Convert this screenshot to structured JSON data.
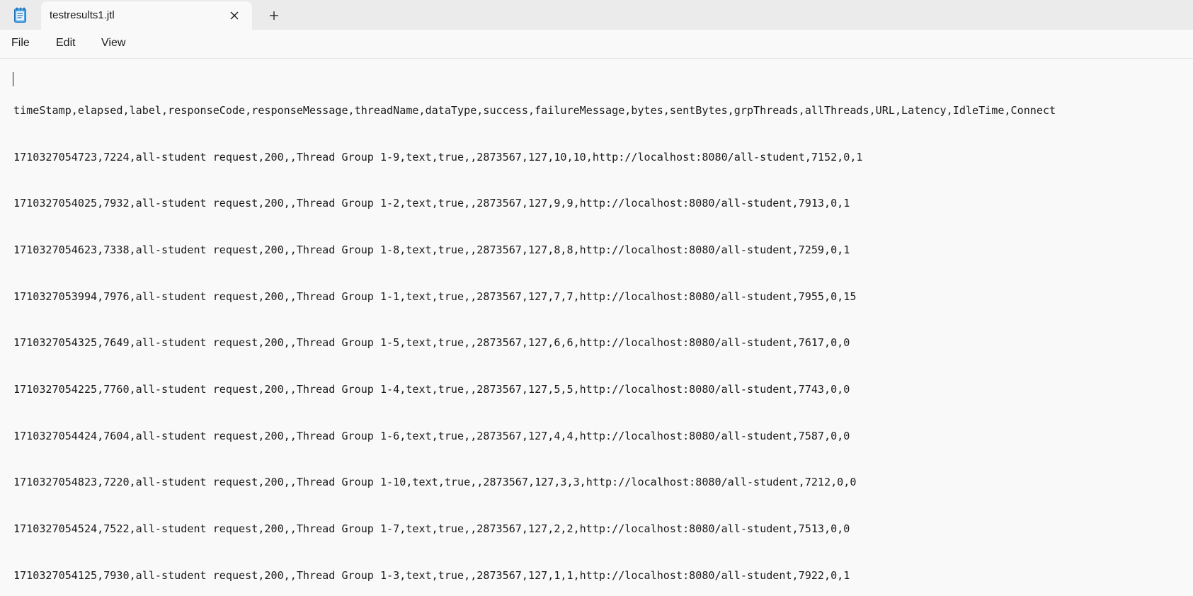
{
  "window": {
    "tab_title": "testresults1.jtl",
    "app_icon": "notepad-icon",
    "close_icon": "close-icon",
    "new_tab_icon": "plus-icon"
  },
  "menu": {
    "file": "File",
    "edit": "Edit",
    "view": "View"
  },
  "document": {
    "lines": [
      "timeStamp,elapsed,label,responseCode,responseMessage,threadName,dataType,success,failureMessage,bytes,sentBytes,grpThreads,allThreads,URL,Latency,IdleTime,Connect",
      "1710327054723,7224,all-student request,200,,Thread Group 1-9,text,true,,2873567,127,10,10,http://localhost:8080/all-student,7152,0,1",
      "1710327054025,7932,all-student request,200,,Thread Group 1-2,text,true,,2873567,127,9,9,http://localhost:8080/all-student,7913,0,1",
      "1710327054623,7338,all-student request,200,,Thread Group 1-8,text,true,,2873567,127,8,8,http://localhost:8080/all-student,7259,0,1",
      "1710327053994,7976,all-student request,200,,Thread Group 1-1,text,true,,2873567,127,7,7,http://localhost:8080/all-student,7955,0,15",
      "1710327054325,7649,all-student request,200,,Thread Group 1-5,text,true,,2873567,127,6,6,http://localhost:8080/all-student,7617,0,0",
      "1710327054225,7760,all-student request,200,,Thread Group 1-4,text,true,,2873567,127,5,5,http://localhost:8080/all-student,7743,0,0",
      "1710327054424,7604,all-student request,200,,Thread Group 1-6,text,true,,2873567,127,4,4,http://localhost:8080/all-student,7587,0,0",
      "1710327054823,7220,all-student request,200,,Thread Group 1-10,text,true,,2873567,127,3,3,http://localhost:8080/all-student,7212,0,0",
      "1710327054524,7522,all-student request,200,,Thread Group 1-7,text,true,,2873567,127,2,2,http://localhost:8080/all-student,7513,0,0",
      "1710327054125,7930,all-student request,200,,Thread Group 1-3,text,true,,2873567,127,1,1,http://localhost:8080/all-student,7922,0,1"
    ]
  }
}
